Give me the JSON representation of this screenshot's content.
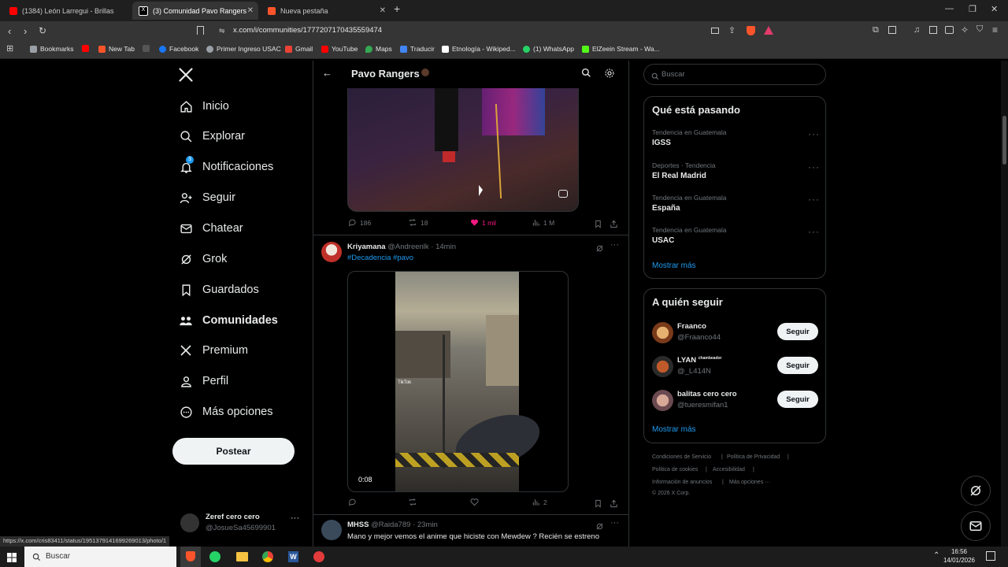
{
  "browser": {
    "tabs": [
      {
        "label": "(1384) León Larregui - Brillas",
        "color": "#ff0000"
      },
      {
        "label": "(3) Comunidad Pavo Rangers",
        "color": "#ffffff"
      },
      {
        "label": "Nueva pestaña",
        "color": "#fb542b"
      }
    ],
    "url": "x.com/i/communities/1777207170435559474",
    "bookmarks": [
      {
        "label": "Bookmarks",
        "color": "#9aa0a6"
      },
      {
        "label": "",
        "color": "#ff0000"
      },
      {
        "label": "New Tab",
        "color": "#fb542b"
      },
      {
        "label": "",
        "color": "#555555"
      },
      {
        "label": "Facebook",
        "color": "#1877f2"
      },
      {
        "label": "Primer Ingreso USAC",
        "color": "#9aa0a6"
      },
      {
        "label": "Gmail",
        "color": "#ea4335"
      },
      {
        "label": "YouTube",
        "color": "#ff0000"
      },
      {
        "label": "Maps",
        "color": "#34a853"
      },
      {
        "label": "Traducir",
        "color": "#4285f4"
      },
      {
        "label": "Etnología - Wikiped...",
        "color": "#ffffff"
      },
      {
        "label": "(1) WhatsApp",
        "color": "#25d366"
      },
      {
        "label": "ElZeein Stream - Wa...",
        "color": "#53fc18"
      }
    ]
  },
  "sidebar": {
    "items": [
      {
        "label": "Inicio",
        "icon": "home-icon"
      },
      {
        "label": "Explorar",
        "icon": "search-icon"
      },
      {
        "label": "Notificaciones",
        "icon": "bell-icon",
        "badge": "3"
      },
      {
        "label": "Seguir",
        "icon": "person-plus-icon"
      },
      {
        "label": "Chatear",
        "icon": "mail-icon"
      },
      {
        "label": "Grok",
        "icon": "grok-icon"
      },
      {
        "label": "Guardados",
        "icon": "bookmark-icon"
      },
      {
        "label": "Comunidades",
        "icon": "communities-icon"
      },
      {
        "label": "Premium",
        "icon": "x-icon"
      },
      {
        "label": "Perfil",
        "icon": "person-icon"
      },
      {
        "label": "Más opciones",
        "icon": "more-circle-icon"
      }
    ],
    "post_button": "Postear",
    "account": {
      "name": "Zeref cero cero",
      "handle": "@JosueSa45699901"
    }
  },
  "header": {
    "title": "Pavo Rangers"
  },
  "posts": [
    {
      "actions": {
        "replies": "186",
        "reposts": "18",
        "likes": "1 mil",
        "views": "1 M"
      }
    },
    {
      "author": "Kriyamana",
      "handle": "@Andreenlk",
      "time": "14min",
      "hashtags": "#Decadencia #pavo",
      "video": {
        "duration": "0:08",
        "watermark": "TikTok"
      },
      "actions": {
        "replies": "",
        "reposts": "",
        "likes": "",
        "views": "2"
      }
    },
    {
      "author": "MHSS",
      "handle": "@Raida789",
      "time": "23min",
      "text": "Mano y mejor vemos el anime que hiciste con Mewdew ? Recién se estreno"
    }
  ],
  "search": {
    "placeholder": "Buscar"
  },
  "trends": {
    "title": "Qué está pasando",
    "items": [
      {
        "context": "Tendencia en Guatemala",
        "name": "IGSS"
      },
      {
        "context": "Deportes · Tendencia",
        "name": "El Real Madrid"
      },
      {
        "context": "Tendencia en Guatemala",
        "name": "España"
      },
      {
        "context": "Tendencia en Guatemala",
        "name": "USAC"
      }
    ],
    "show_more": "Mostrar más"
  },
  "follow": {
    "title": "A quién seguir",
    "items": [
      {
        "name": "Fraanco",
        "handle": "@Fraanco44",
        "button": "Seguir"
      },
      {
        "name": "LYAN",
        "tag": "chambeador",
        "handle": "@_L414N",
        "button": "Seguir"
      },
      {
        "name": "balitas cero cero",
        "handle": "@tueresmifan1",
        "button": "Seguir"
      }
    ],
    "show_more": "Mostrar más"
  },
  "footer": {
    "links": [
      "Condiciones de Servicio",
      "Política de Privacidad",
      "Política de cookies",
      "Accesibilidad",
      "Información de anuncios",
      "Más opciones ···"
    ],
    "copyright": "© 2026 X Corp."
  },
  "status_url": "https://x.com/cris83411/status/1951379141699269013/photo/1",
  "taskbar": {
    "search": "Buscar",
    "time": "16:56",
    "date": "14/01/2026"
  },
  "colors": {
    "accent": "#1d9bf0",
    "like": "#f91880",
    "bg": "#000000",
    "border": "#2f3336"
  }
}
